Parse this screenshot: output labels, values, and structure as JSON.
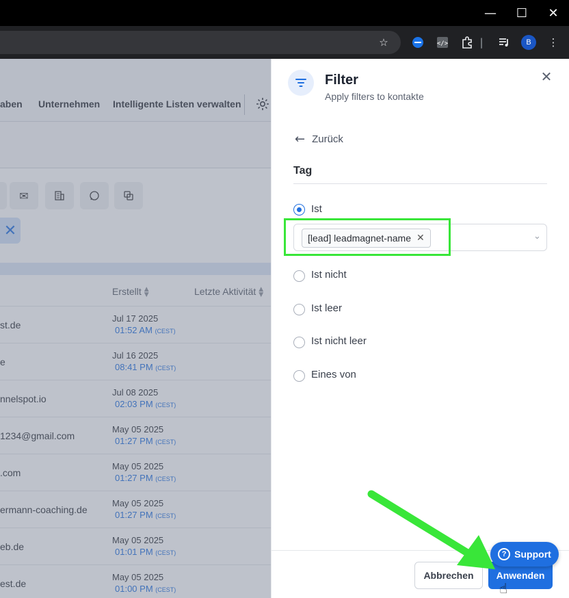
{
  "window": {
    "minimize": "—",
    "maximize": "☐",
    "close": "✕"
  },
  "toolbar": {
    "profile_initial": "B"
  },
  "nav": {
    "items": [
      "aben",
      "Unternehmen",
      "Intelligente Listen verwalten"
    ]
  },
  "table": {
    "headers": [
      "Erstellt",
      "Letzte Aktivität"
    ],
    "rows": [
      {
        "email": "st.de",
        "date": "Jul 17 2025",
        "time": "01:52 AM",
        "tz": "(CEST)"
      },
      {
        "email": "e",
        "date": "Jul 16 2025",
        "time": "08:41 PM",
        "tz": "(CEST)"
      },
      {
        "email": "nnelspot.io",
        "date": "Jul 08 2025",
        "time": "02:03 PM",
        "tz": "(CEST)"
      },
      {
        "email": "1234@gmail.com",
        "date": "May 05 2025",
        "time": "01:27 PM",
        "tz": "(CEST)"
      },
      {
        "email": ".com",
        "date": "May 05 2025",
        "time": "01:27 PM",
        "tz": "(CEST)"
      },
      {
        "email": "ermann-coaching.de",
        "date": "May 05 2025",
        "time": "01:27 PM",
        "tz": "(CEST)"
      },
      {
        "email": "eb.de",
        "date": "May 05 2025",
        "time": "01:01 PM",
        "tz": "(CEST)"
      },
      {
        "email": "est.de",
        "date": "May 05 2025",
        "time": "01:00 PM",
        "tz": "(CEST)"
      }
    ]
  },
  "panel": {
    "title": "Filter",
    "subtitle": "Apply filters to kontakte",
    "back_label": "Zurück",
    "section_title": "Tag",
    "options": [
      {
        "label": "Ist",
        "selected": true
      },
      {
        "label": "Ist nicht",
        "selected": false
      },
      {
        "label": "Ist leer",
        "selected": false
      },
      {
        "label": "Ist nicht leer",
        "selected": false
      },
      {
        "label": "Eines von",
        "selected": false
      }
    ],
    "selected_tag": "[lead] leadmagnet-name",
    "cancel_label": "Abbrechen",
    "apply_label": "Anwenden"
  },
  "support": {
    "label": "Support",
    "icon_glyph": "?"
  },
  "colors": {
    "accent": "#1f6fe0",
    "annotation": "#39e639"
  }
}
